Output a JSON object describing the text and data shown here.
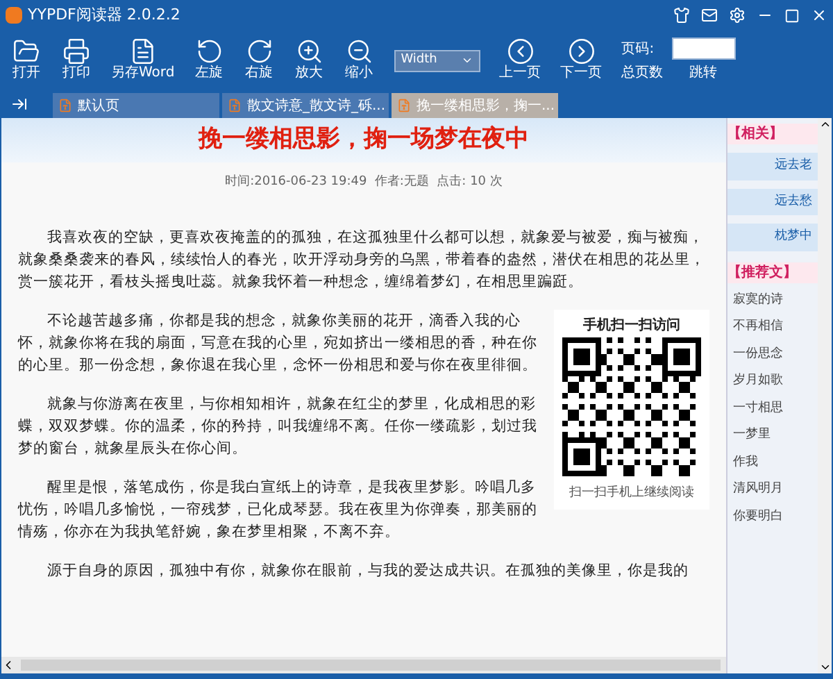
{
  "window": {
    "title": "YYPDF阅读器 2.0.2.2"
  },
  "toolbar": [
    {
      "kind": "open",
      "label": "打开"
    },
    {
      "kind": "print",
      "label": "打印"
    },
    {
      "kind": "word",
      "label": "另存Word"
    },
    {
      "kind": "rotate_left",
      "label": "左旋"
    },
    {
      "kind": "rotate_right",
      "label": "右旋"
    },
    {
      "kind": "zoom_in",
      "label": "放大"
    },
    {
      "kind": "zoom_out",
      "label": "缩小"
    },
    {
      "kind": "select",
      "label": "Width"
    },
    {
      "kind": "prev",
      "label": "上一页"
    },
    {
      "kind": "next",
      "label": "下一页"
    }
  ],
  "page_box": {
    "label": "页码:",
    "sub_label": "总页数",
    "button": "跳转"
  },
  "tabs": [
    {
      "label": "默认页",
      "selected": false
    },
    {
      "label": "散文诗意_散文诗_砾...",
      "selected": false
    },
    {
      "label": "挽一缕相思影，掬一...",
      "selected": true
    }
  ],
  "article": {
    "title": "挽一缕相思影，掬一场梦在夜中",
    "meta": "时间:2016-06-23 19:49  作者:无题  点击: 10 次",
    "paragraphs": [
      "我喜欢夜的空缺，更喜欢夜掩盖的的孤独，在这孤独里什么都可以想，就象爱与被爱，痴与被痴，就象桑桑袭来的春风，续续怡人的春光，吹开浮动身旁的乌黑，带着春的盎然，潜伏在相思的花丛里，赏一簇花开，看枝头摇曳吐蕊。就象我怀着一种想念，缠绵着梦幻，在相思里蹁跹。",
      "不论越苦越多痛，你都是我的想念，就象你美丽的花开，滴香入我的心怀，就象你将在我的扇面，写意在我的心里，宛如挤出一缕相思的香，种在你的心里。那一份念想，象你退在我心里，念怀一份相思和爱与你在夜里徘徊。",
      "就象与你游离在夜里，与你相知相许，就象在红尘的梦里，化成相思的彩蝶，双双梦蝶。你的温柔，你的矜持，叫我缠绵不离。任你一缕疏影，划过我梦的窗台，就象星辰头在你心间。",
      "醒里是恨，落笔成伤，你是我白宣纸上的诗章，是我夜里梦影。吟唱几多忧伤，吟唱几多愉悦，一帘残梦，已化成琴瑟。我在夜里为你弹奏，那美丽的情殇，你亦在为我执笔舒婉，象在梦里相聚，不离不弃。",
      "源于自身的原因，孤独中有你，就象你在眼前，与我的爱达成共识。在孤独的美像里，你是我的"
    ]
  },
  "qr_panel": {
    "title": "手机扫一扫访问",
    "caption": "扫一扫手机上继续阅读"
  },
  "sidebar": [
    {
      "heading": "【相关】",
      "items": [
        "远去老",
        "远去愁",
        "枕梦中"
      ]
    },
    {
      "heading": "【推荐文】",
      "items": [
        "寂寞的诗",
        "不再相信",
        "一份思念",
        "岁月如歌",
        "一寸相思",
        "一梦里",
        "作我",
        "清风明月",
        "你要明白"
      ]
    }
  ]
}
